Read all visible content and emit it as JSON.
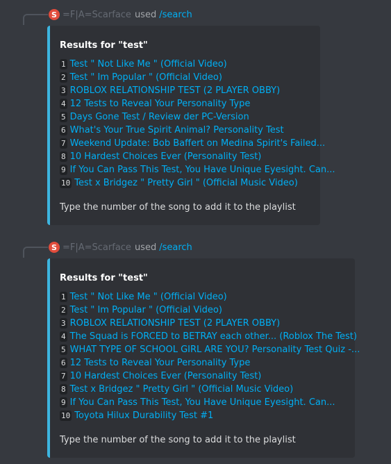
{
  "messages": [
    {
      "user": "=F|A=Scarface",
      "avatar_letter": "S",
      "used": "used",
      "command": "/search",
      "embed": {
        "title": "Results for \"test\"",
        "results": [
          {
            "num": "1",
            "title": "Test \" Not Like Me \" (Official Video)"
          },
          {
            "num": "2",
            "title": "Test \" Im Popular \" (Official Video)"
          },
          {
            "num": "3",
            "title": "ROBLOX RELATIONSHIP TEST (2 PLAYER OBBY)"
          },
          {
            "num": "4",
            "title": "12 Tests to Reveal Your Personality Type"
          },
          {
            "num": "5",
            "title": "Days Gone Test / Review der PC-Version"
          },
          {
            "num": "6",
            "title": "What's Your True Spirit Animal? Personality Test"
          },
          {
            "num": "7",
            "title": "Weekend Update: Bob Baffert on Medina Spirit's Failed..."
          },
          {
            "num": "8",
            "title": "10 Hardest Choices Ever (Personality Test)"
          },
          {
            "num": "9",
            "title": "If You Can Pass This Test, You Have Unique Eyesight. Can..."
          },
          {
            "num": "10",
            "title": "Test x Bridgez \" Pretty Girl \" (Official Music Video)"
          }
        ],
        "footer": "Type the number of the song to add it to the playlist"
      }
    },
    {
      "user": "=F|A=Scarface",
      "avatar_letter": "S",
      "used": "used",
      "command": "/search",
      "embed": {
        "title": "Results for \"test\"",
        "results": [
          {
            "num": "1",
            "title": "Test \" Not Like Me \" (Official Video)"
          },
          {
            "num": "2",
            "title": "Test \" Im Popular \" (Official Video)"
          },
          {
            "num": "3",
            "title": "ROBLOX RELATIONSHIP TEST (2 PLAYER OBBY)"
          },
          {
            "num": "4",
            "title": "The Squad is FORCED to BETRAY each other... (Roblox The Test)"
          },
          {
            "num": "5",
            "title": "WHAT TYPE OF SCHOOL GIRL ARE YOU? Personality Test Quiz -..."
          },
          {
            "num": "6",
            "title": "12 Tests to Reveal Your Personality Type"
          },
          {
            "num": "7",
            "title": "10 Hardest Choices Ever (Personality Test)"
          },
          {
            "num": "8",
            "title": "Test x Bridgez \" Pretty Girl \" (Official Music Video)"
          },
          {
            "num": "9",
            "title": "If You Can Pass This Test, You Have Unique Eyesight. Can..."
          },
          {
            "num": "10",
            "title": "Toyota Hilux Durability Test #1"
          }
        ],
        "footer": "Type the number of the song to add it to the playlist"
      }
    }
  ]
}
